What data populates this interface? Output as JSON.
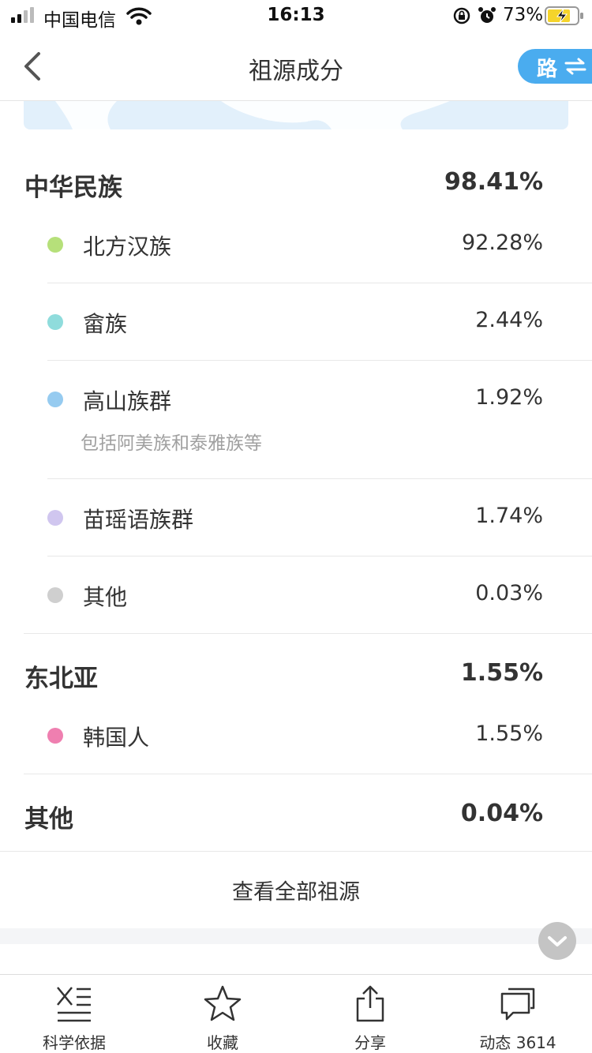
{
  "status_bar": {
    "carrier": "中国电信",
    "time": "16:13",
    "battery_percent": "73%",
    "battery_level": 0.73
  },
  "nav": {
    "title": "祖源成分",
    "route_label": "路"
  },
  "ancestry": {
    "groups": [
      {
        "name": "中华民族",
        "percent": "98.41%",
        "items": [
          {
            "name": "北方汉族",
            "percent": "92.28%",
            "color": "#b6e07a"
          },
          {
            "name": "畲族",
            "percent": "2.44%",
            "color": "#8fdcdc"
          },
          {
            "name": "高山族群",
            "percent": "1.92%",
            "color": "#96cbf0",
            "note": "包括阿美族和泰雅族等"
          },
          {
            "name": "苗瑶语族群",
            "percent": "1.74%",
            "color": "#d0c6ef"
          },
          {
            "name": "其他",
            "percent": "0.03%",
            "color": "#cfcfcf"
          }
        ]
      },
      {
        "name": "东北亚",
        "percent": "1.55%",
        "items": [
          {
            "name": "韩国人",
            "percent": "1.55%",
            "color": "#ef7fb0"
          }
        ]
      },
      {
        "name": "其他",
        "percent": "0.04%",
        "items": []
      }
    ],
    "view_all": "查看全部祖源"
  },
  "tabbar": {
    "tabs": [
      {
        "label": "科学依据",
        "icon": "dna-list-icon"
      },
      {
        "label": "收藏",
        "icon": "star-icon"
      },
      {
        "label": "分享",
        "icon": "share-icon"
      },
      {
        "label": "动态 3614",
        "icon": "chat-bubble-icon"
      }
    ]
  },
  "colors": {
    "accent": "#4aacef",
    "divider": "#e8e8e8",
    "note_text": "#a0a0a0"
  }
}
